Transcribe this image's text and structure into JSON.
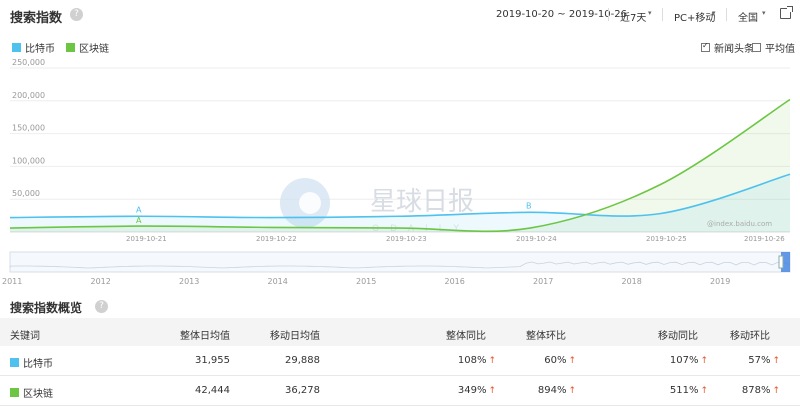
{
  "header": {
    "title": "搜索指数",
    "help": "?",
    "date_range": "2019-10-20 ~ 2019-10-26",
    "period": "近7天",
    "device": "PC+移动",
    "region": "全国"
  },
  "legend": [
    {
      "label": "比特币",
      "color": "#4ec1ee"
    },
    {
      "label": "区块链",
      "color": "#6cc644"
    }
  ],
  "options": [
    {
      "label": "新闻头条",
      "checked": true
    },
    {
      "label": "平均值",
      "checked": false
    }
  ],
  "chart_data": {
    "type": "area",
    "x": [
      "2019-10-20",
      "2019-10-21",
      "2019-10-22",
      "2019-10-23",
      "2019-10-24",
      "2019-10-25",
      "2019-10-26"
    ],
    "tick_labels": [
      "2019-10-21",
      "2019-10-22",
      "2019-10-23",
      "2019-10-24",
      "2019-10-25",
      "2019-10-26"
    ],
    "y_ticks": [
      "250,000",
      "200,000",
      "150,000",
      "100,000",
      "50,000"
    ],
    "ylim": [
      0,
      250000
    ],
    "grid": true,
    "watermark": "@index.baidu.com",
    "series": [
      {
        "name": "比特币",
        "color": "#4ec1ee",
        "values": [
          22000,
          24000,
          22000,
          24000,
          30000,
          28000,
          88000
        ]
      },
      {
        "name": "区块链",
        "color": "#6cc644",
        "values": [
          6000,
          9000,
          7000,
          6000,
          6000,
          72000,
          202000
        ]
      }
    ],
    "annotations": [
      {
        "label": "A",
        "x": "2019-10-21"
      },
      {
        "label": "B",
        "x": "2019-10-24"
      }
    ],
    "overview_years": [
      "2011",
      "2012",
      "2013",
      "2014",
      "2015",
      "2016",
      "2017",
      "2018",
      "2019"
    ]
  },
  "overview": {
    "title": "搜索指数概览",
    "columns": [
      "关键词",
      "整体日均值",
      "移动日均值",
      "整体同比",
      "整体环比",
      "移动同比",
      "移动环比"
    ],
    "rows": [
      {
        "keyword": "比特币",
        "color": "#4ec1ee",
        "overall_avg": "31,955",
        "mobile_avg": "29,888",
        "overall_yoy": "108%",
        "overall_mom": "60%",
        "mobile_yoy": "107%",
        "mobile_mom": "57%"
      },
      {
        "keyword": "区块链",
        "color": "#6cc644",
        "overall_avg": "42,444",
        "mobile_avg": "36,278",
        "overall_yoy": "349%",
        "overall_mom": "894%",
        "mobile_yoy": "511%",
        "mobile_mom": "878%"
      }
    ]
  },
  "watermark_logo": {
    "text": "星球日报",
    "subtext": "ODAILY"
  },
  "icons": {
    "arrow_up": "↑",
    "caret": "▾"
  }
}
